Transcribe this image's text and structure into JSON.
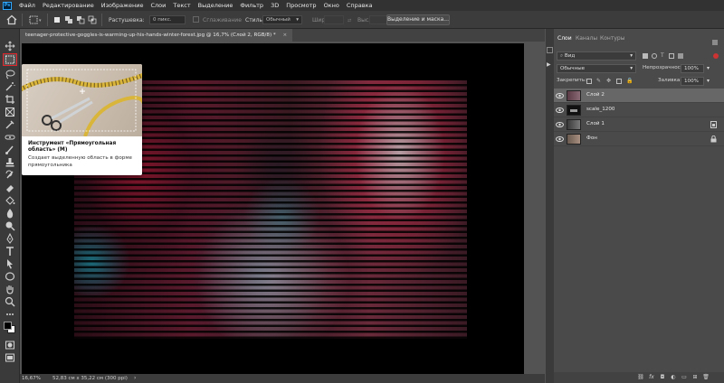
{
  "app": {
    "logo": "Ps"
  },
  "menu": [
    "Файл",
    "Редактирование",
    "Изображение",
    "Слои",
    "Текст",
    "Выделение",
    "Фильтр",
    "3D",
    "Просмотр",
    "Окно",
    "Справка"
  ],
  "options_bar": {
    "feather_label": "Растушевка:",
    "feather_value": "0 пикс.",
    "antialias_label": "Сглаживание",
    "style_label": "Стиль:",
    "style_value": "Обычный",
    "width_label": "Шир.:",
    "height_label": "Выс.:",
    "select_mask_button": "Выделение и маска..."
  },
  "document": {
    "tab_title": "teenager-protective-goggles-is-warming-up-his-hands-winter-forest.jpg @ 16,7% (Слой 2, RGB/8) *"
  },
  "status": {
    "zoom": "16,67%",
    "doc_size": "52,83 см x 35,22 см (300 ppi)"
  },
  "tooltip": {
    "title": "Инструмент «Прямоугольная область» (M)",
    "description": "Создает выделенную область в форме прямоугольника"
  },
  "layers_panel": {
    "tabs": [
      "Слои",
      "Каналы",
      "Контуры"
    ],
    "active_tab": "Слои",
    "filter_value": "Вид",
    "blend_mode": "Обычные",
    "opacity_label": "Непрозрачность:",
    "opacity_value": "100%",
    "lock_label": "Закрепить:",
    "fill_label": "Заливка:",
    "fill_value": "100%",
    "layers": [
      {
        "name": "Слой 2",
        "selected": true
      },
      {
        "name": "scale_1200",
        "selected": false
      },
      {
        "name": "Слой 1",
        "selected": false
      },
      {
        "name": "Фон",
        "selected": false
      }
    ]
  },
  "colors": {
    "active_tool_outline": "#e0262b",
    "foreground": "#000000",
    "background": "#ffffff"
  }
}
